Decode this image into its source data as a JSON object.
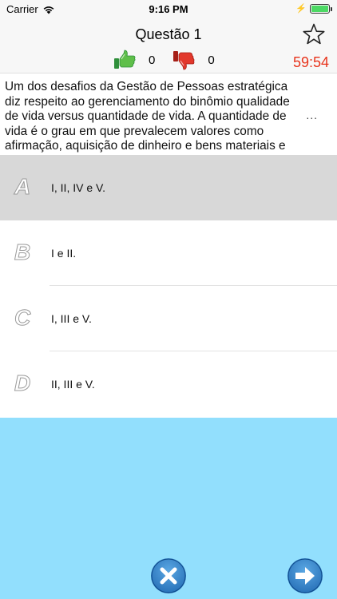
{
  "status": {
    "carrier": "Carrier",
    "time": "9:16 PM"
  },
  "header": {
    "title": "Questão 1",
    "likes": "0",
    "dislikes": "0",
    "timer": "59:54"
  },
  "question": {
    "text": "Um dos desafios da Gestão de Pessoas estratégica diz respeito ao gerenciamento do binômio qualidade de vida versus quantidade de vida. A quantidade de vida é o grau em que prevalecem valores como afirmação, aquisição de dinheiro e bens materiais e",
    "more": "..."
  },
  "answers": [
    {
      "letter": "A",
      "text": "I, II, IV e V.",
      "selected": true
    },
    {
      "letter": "B",
      "text": "I e II.",
      "selected": false
    },
    {
      "letter": "C",
      "text": "I, III e V.",
      "selected": false
    },
    {
      "letter": "D",
      "text": "II, III e V.",
      "selected": false
    }
  ],
  "colors": {
    "timer": "#e8341c",
    "bottom_background": "#92dffd",
    "selected_answer": "#d8d8d8",
    "button": "#1b63ad"
  },
  "icons": {
    "like": "thumbs-up-icon",
    "dislike": "thumbs-down-icon",
    "favorite": "star-icon",
    "cancel": "close-icon",
    "next": "arrow-right-icon"
  }
}
